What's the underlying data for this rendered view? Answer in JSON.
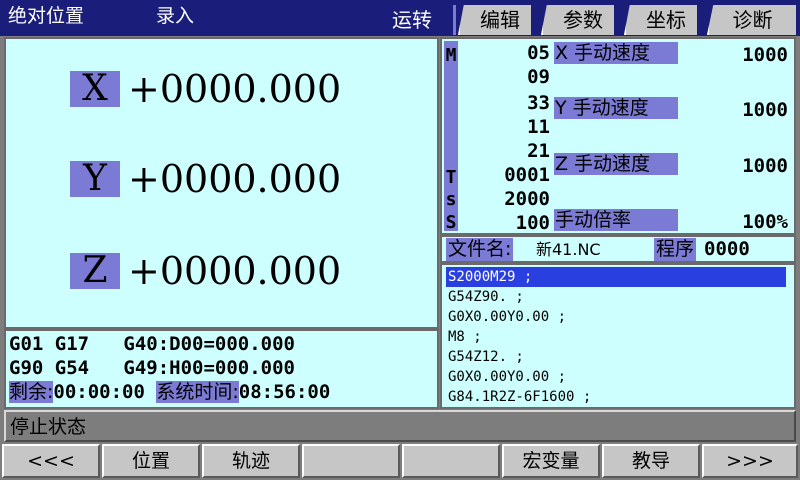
{
  "header": {
    "position_mode": "绝对位置",
    "input_mode": "录入",
    "tabs": [
      {
        "label": "运转",
        "active": true
      },
      {
        "label": "编辑",
        "active": false
      },
      {
        "label": "参数",
        "active": false
      },
      {
        "label": "坐标",
        "active": false
      },
      {
        "label": "诊断",
        "active": false
      }
    ]
  },
  "coordinates": [
    {
      "axis": "X",
      "value": "+0000.000"
    },
    {
      "axis": "Y",
      "value": "+0000.000"
    },
    {
      "axis": "Z",
      "value": "+0000.000"
    }
  ],
  "modal": {
    "line1": "G01 G17   G40:D00=000.000",
    "line2": "G90 G54   G49:H00=000.000",
    "remaining_label": "剩余:",
    "remaining_value": "00:00:00",
    "system_time_label": "系统时间:",
    "system_time_value": "08:56:00"
  },
  "info": {
    "strip_letters": {
      "m": "M",
      "t": "T",
      "s1": "s",
      "s2": "S"
    },
    "m_codes": [
      "05",
      "09",
      "33",
      "11",
      "21"
    ],
    "t_value": "0001",
    "s_value": "2000",
    "s_actual": "100",
    "params": [
      {
        "label": "X 手动速度",
        "value": "1000"
      },
      {
        "label": "Y 手动速度",
        "value": "1000"
      },
      {
        "label": "Z 手动速度",
        "value": "1000"
      },
      {
        "label": "手动倍率",
        "value": "100%"
      }
    ]
  },
  "file": {
    "label": "文件名:",
    "name": "新41.NC",
    "program_label": "程序",
    "program_number": "0000"
  },
  "program_lines": [
    "S2000M29 ;",
    "G54Z90. ;",
    "G0X0.00Y0.00 ;",
    "M8 ;",
    "G54Z12. ;",
    "G0X0.00Y0.00 ;",
    "G84.1R2Z-6F1600 ;"
  ],
  "status": {
    "text": "停止状态"
  },
  "softkeys": [
    "<<<",
    "位置",
    "轨迹",
    "",
    "",
    "宏变量",
    "教导",
    ">>>"
  ],
  "colors": {
    "panel_bg": "#ceffff",
    "label_bg": "#7b7bd6",
    "title_bar": "#1a1d7a",
    "selection": "#2a3fe0",
    "button": "#c6c6c6"
  }
}
